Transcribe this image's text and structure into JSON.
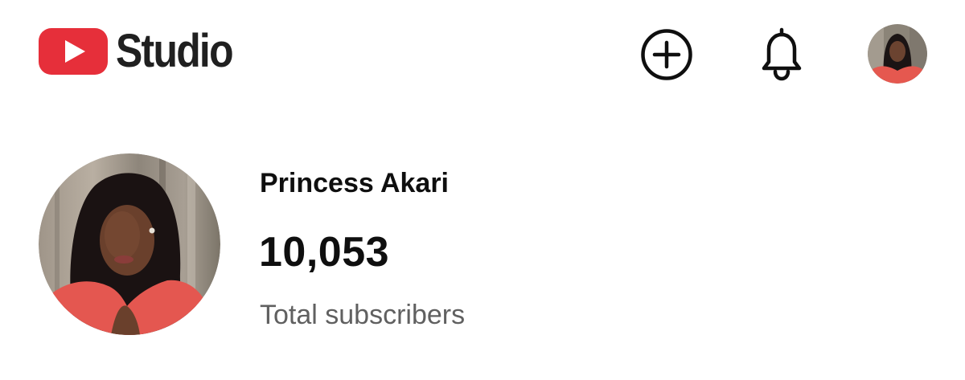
{
  "header": {
    "logo_text": "Studio",
    "brand_color": "#ff0033",
    "actions": {
      "create_icon": "plus-circle-icon",
      "notifications_icon": "bell-icon",
      "account_icon": "avatar"
    }
  },
  "channel": {
    "name": "Princess Akari",
    "subscriber_count": "10,053",
    "subscriber_label": "Total subscribers"
  },
  "colors": {
    "text_primary": "#0f0f0f",
    "text_secondary": "#606060",
    "avatar_top_accent": "#e5584f"
  }
}
